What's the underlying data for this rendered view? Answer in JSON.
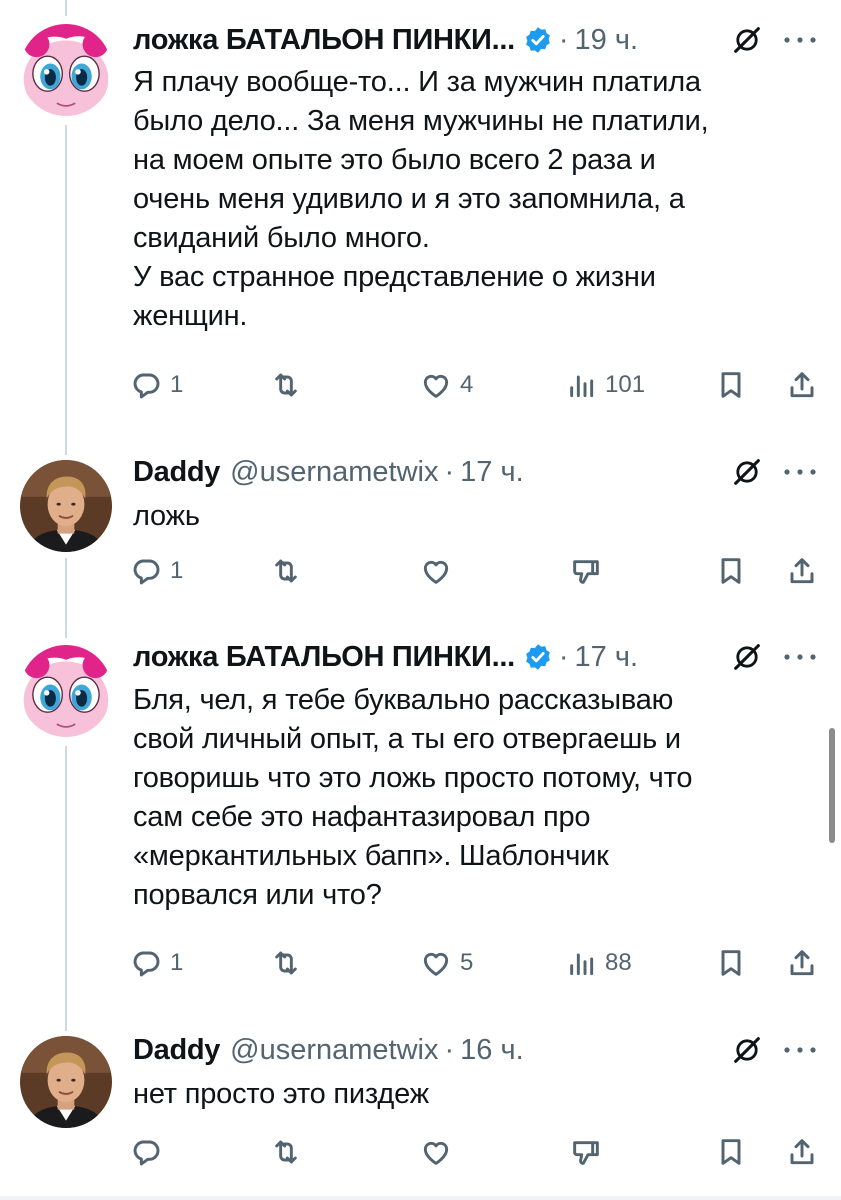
{
  "tweets": [
    {
      "name": "ложка БАТАЛЬОН ПИНКИ...",
      "handle": "",
      "time": "19 ч.",
      "verified": true,
      "avatar": "pinkie-pie-avatar",
      "text": "Я плачу вообще-то... И за мужчин платила\nбыло дело... За меня мужчины не платили,\nна моем опыте это было всего 2 раза и\nочень меня удивило и я это запомнила, а\nсвиданий было много.\nУ вас странное представление о жизни\nженщин.",
      "replies": "1",
      "retweets": "",
      "likes": "4",
      "views": "101"
    },
    {
      "name": "Daddy",
      "handle": "@usernametwix",
      "time": "17 ч.",
      "verified": false,
      "avatar": "man-portrait-avatar",
      "text": "ложь",
      "replies": "1",
      "retweets": "",
      "likes": "",
      "views": ""
    },
    {
      "name": "ложка БАТАЛЬОН ПИНКИ...",
      "handle": "",
      "time": "17 ч.",
      "verified": true,
      "avatar": "pinkie-pie-avatar",
      "text": "Бля, чел, я тебе буквально рассказываю\nсвой личный опыт, а ты его отвергаешь и\nговоришь что это ложь просто потому, что\nсам себе это нафантазировал про\n«меркантильных бапп». Шаблончик\nпорвался или что?",
      "replies": "1",
      "retweets": "",
      "likes": "5",
      "views": "88"
    },
    {
      "name": "Daddy",
      "handle": "@usernametwix",
      "time": "16 ч.",
      "verified": false,
      "avatar": "man-portrait-avatar",
      "text": "нет просто это пиздеж",
      "replies": "",
      "retweets": "",
      "likes": "",
      "views": ""
    }
  ],
  "icons": {
    "reply": "reply-icon",
    "retweet": "retweet-icon",
    "like": "heart-icon",
    "views": "views-icon",
    "downvote": "thumbs-down-icon",
    "bookmark": "bookmark-icon",
    "share": "share-icon",
    "grok": "grok-icon",
    "more": "more-icon",
    "verified": "verified-badge-icon"
  },
  "colors": {
    "text": "#0f1419",
    "secondary": "#536471",
    "verified": "#1d9bf0",
    "thread_line": "#cfd9de",
    "pinkie_pink": "#f8b9d4",
    "pinkie_mane": "#e0248a"
  }
}
